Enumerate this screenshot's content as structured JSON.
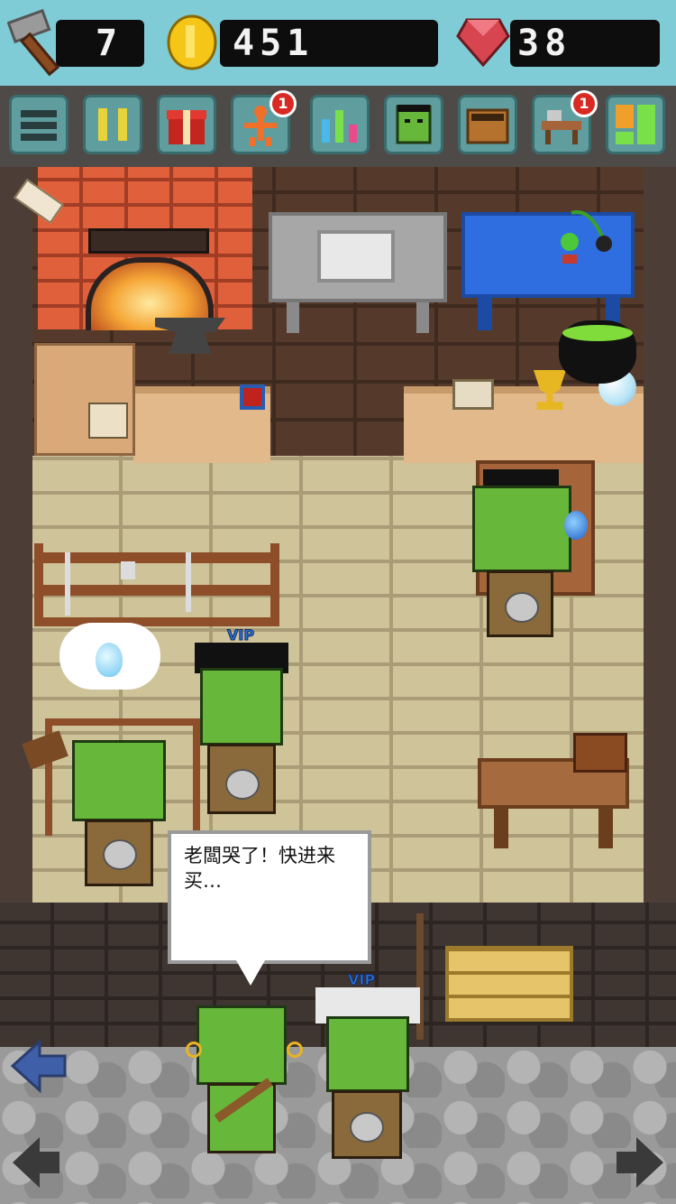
{
  "resources": {
    "hammers": "7",
    "coins": "451",
    "gems": "38"
  },
  "toolbar": {
    "items": [
      {
        "name": "menu-icon"
      },
      {
        "name": "pause-icon"
      },
      {
        "name": "gift-icon"
      },
      {
        "name": "skill-tree-icon",
        "badge": "1"
      },
      {
        "name": "stats-icon"
      },
      {
        "name": "customers-icon"
      },
      {
        "name": "storage-box-icon"
      },
      {
        "name": "workbench-icon",
        "badge": "1"
      },
      {
        "name": "layout-icon"
      }
    ]
  },
  "characters": {
    "vip_label_1": "VIP",
    "vip_label_2": "VIP"
  },
  "speech_bubble": {
    "text": "老闆哭了！快进来买…"
  },
  "colors": {
    "topbar": "#7fcbd6",
    "toolbar_button": "#5f9d9e",
    "badge": "#d82a22",
    "orc_skin": "#67b83a"
  }
}
